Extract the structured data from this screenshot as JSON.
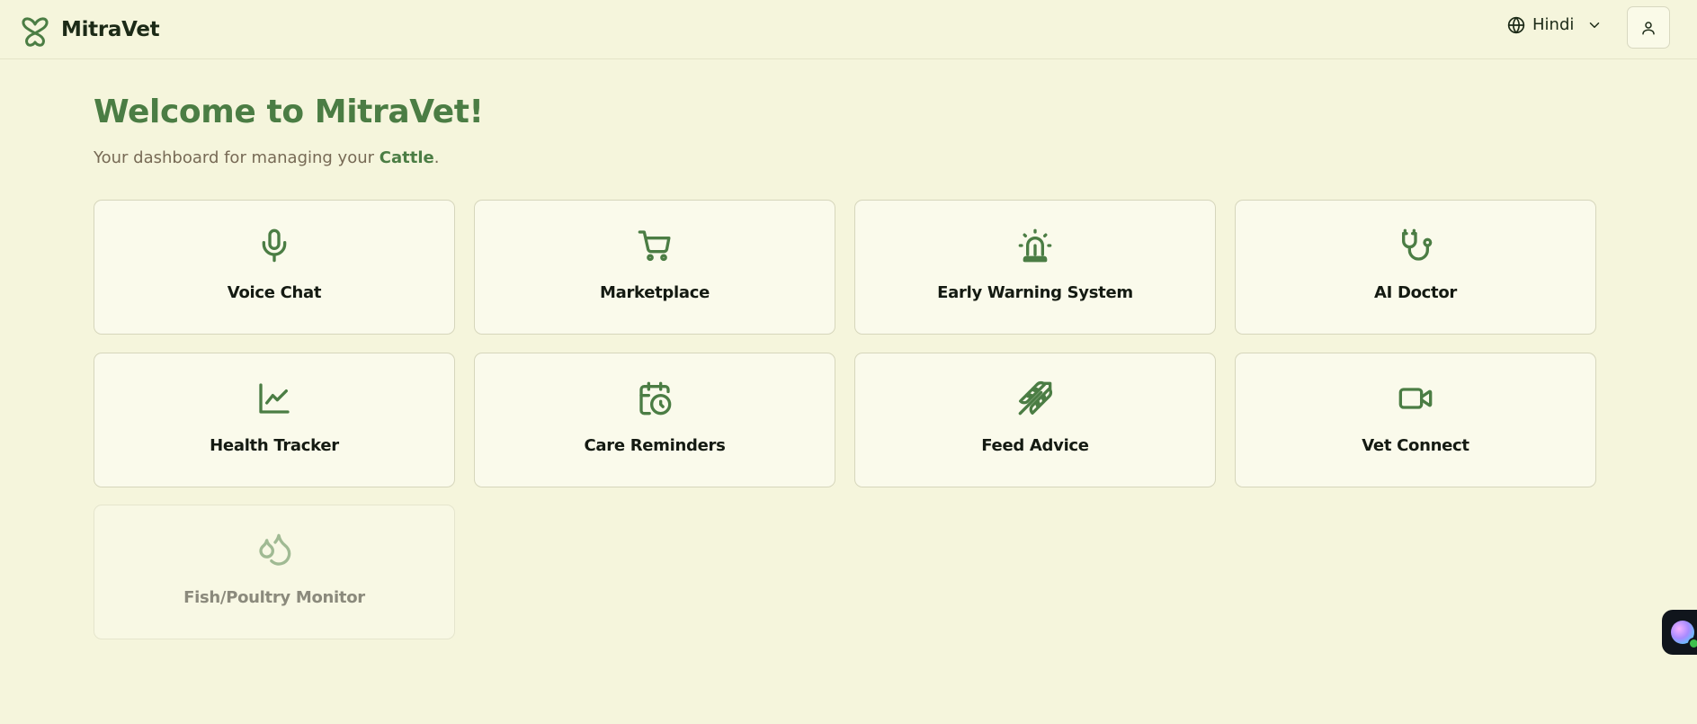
{
  "header": {
    "brand_name": "MitraVet",
    "language": "Hindi",
    "icons": {
      "logo": "paw-heart-logo-icon",
      "language": "globe-icon",
      "dropdown": "chevron-down-icon",
      "profile": "user-icon"
    }
  },
  "main": {
    "title": "Welcome to MitraVet!",
    "subtitle_prefix": "Your dashboard for managing your ",
    "animal": "Cattle",
    "subtitle_suffix": ".",
    "cards": [
      {
        "label": "Voice Chat",
        "icon": "microphone-icon",
        "enabled": true
      },
      {
        "label": "Marketplace",
        "icon": "shopping-cart-icon",
        "enabled": true
      },
      {
        "label": "Early Warning System",
        "icon": "siren-icon",
        "enabled": true
      },
      {
        "label": "AI Doctor",
        "icon": "stethoscope-icon",
        "enabled": true
      },
      {
        "label": "Health Tracker",
        "icon": "line-chart-icon",
        "enabled": true
      },
      {
        "label": "Care Reminders",
        "icon": "calendar-clock-icon",
        "enabled": true
      },
      {
        "label": "Feed Advice",
        "icon": "wheat-icon",
        "enabled": true
      },
      {
        "label": "Vet Connect",
        "icon": "video-camera-icon",
        "enabled": true
      },
      {
        "label": "Fish/Poultry Monitor",
        "icon": "droplets-icon",
        "enabled": false
      }
    ]
  },
  "colors": {
    "background": "#f5f5dc",
    "accent": "#4b7d44",
    "card_bg": "#fafaeb",
    "card_border": "#d6d6bc"
  }
}
